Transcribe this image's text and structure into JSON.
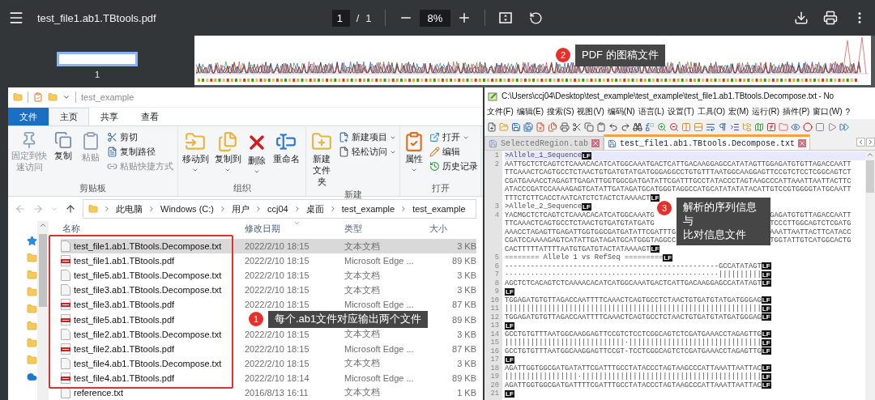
{
  "pdf_viewer": {
    "title": "test_file1.ab1.TBtools.pdf",
    "page": "1",
    "page_separator": "/",
    "page_total": "1",
    "zoom": "8%",
    "thumbnail_label": "1",
    "callout": {
      "number": "2",
      "lines": [
        "PDF 的图稿文件"
      ]
    }
  },
  "explorer": {
    "title": "test_example",
    "tabs": [
      {
        "label": "文件",
        "kind": "menu",
        "selected": false
      },
      {
        "label": "主页",
        "kind": "tab",
        "selected": true
      },
      {
        "label": "共享",
        "kind": "tab",
        "selected": false
      },
      {
        "label": "查看",
        "kind": "tab",
        "selected": false
      }
    ],
    "ribbon": [
      {
        "label": "剪贴板",
        "large": [
          {
            "label": "固定到快速访问",
            "has_menu": false,
            "disabled": true
          },
          {
            "label": "复制",
            "has_menu": false,
            "disabled": false
          },
          {
            "label": "粘贴",
            "has_menu": false,
            "disabled": true
          }
        ],
        "small": [
          {
            "label": "剪切",
            "has_menu": false,
            "disabled": false
          },
          {
            "label": "复制路径",
            "has_menu": false,
            "disabled": false
          },
          {
            "label": "粘贴快捷方式",
            "has_menu": false,
            "disabled": true
          }
        ]
      },
      {
        "label": "组织",
        "large": [
          {
            "label": "移动到",
            "has_menu": true,
            "disabled": false
          },
          {
            "label": "复制到",
            "has_menu": true,
            "disabled": false
          },
          {
            "label": "删除",
            "has_menu": true,
            "disabled": false
          },
          {
            "label": "重命名",
            "has_menu": false,
            "disabled": false
          }
        ]
      },
      {
        "label": "新建",
        "large": [
          {
            "label": "新建文件夹",
            "has_menu": false,
            "disabled": false
          }
        ],
        "small": [
          {
            "label": "新建项目",
            "has_menu": true,
            "disabled": false
          },
          {
            "label": "轻松访问",
            "has_menu": true,
            "disabled": false
          }
        ]
      },
      {
        "label": "打开",
        "large": [
          {
            "label": "属性",
            "has_menu": true,
            "disabled": false
          }
        ],
        "small": [
          {
            "label": "打开",
            "has_menu": true,
            "disabled": false
          },
          {
            "label": "编辑",
            "has_menu": false,
            "disabled": false
          },
          {
            "label": "历史记录",
            "has_menu": false,
            "disabled": false
          }
        ]
      }
    ],
    "breadcrumbs": [
      "此电脑",
      "Windows (C:)",
      "用户",
      "ccj04",
      "桌面",
      "test_example",
      "test_example"
    ],
    "columns": [
      "名称",
      "修改日期",
      "类型",
      "大小"
    ],
    "rows": [
      {
        "kind": "txt",
        "name": "test_file1.ab1.TBtools.Decompose.txt",
        "date": "2022/2/10 18:15",
        "type": "文本文档",
        "size": "3 KB",
        "selected": true,
        "boxed": true
      },
      {
        "kind": "pdf",
        "name": "test_file1.ab1.TBtools.pdf",
        "date": "2022/2/10 18:15",
        "type": "Microsoft Edge ...",
        "size": "89 KB",
        "selected": false,
        "boxed": true
      },
      {
        "kind": "txt",
        "name": "test_file5.ab1.TBtools.Decompose.txt",
        "date": "2022/2/10 18:15",
        "type": "文本文档",
        "size": "3 KB",
        "selected": false,
        "boxed": true
      },
      {
        "kind": "txt",
        "name": "test_file3.ab1.TBtools.Decompose.txt",
        "date": "2022/2/10 18:15",
        "type": "文本文档",
        "size": "3 KB",
        "selected": false,
        "boxed": true
      },
      {
        "kind": "pdf",
        "name": "test_file3.ab1.TBtools.pdf",
        "date": "2022/2/10 18:15",
        "type": "Microsoft Edge ...",
        "size": "87 KB",
        "selected": false,
        "boxed": true
      },
      {
        "kind": "pdf",
        "name": "test_file5.ab1.TBtools.pdf",
        "size": "89 KB",
        "selected": false,
        "boxed": true
      },
      {
        "kind": "txt",
        "name": "test_file2.ab1.TBtools.Decompose.txt",
        "date": "2022/2/10 18:15",
        "type": "文本文档",
        "size": "3 KB",
        "selected": false,
        "boxed": true
      },
      {
        "kind": "pdf",
        "name": "test_file2.ab1.TBtools.pdf",
        "date": "2022/2/10 18:15",
        "type": "Microsoft Edge ...",
        "size": "87 KB",
        "selected": false,
        "boxed": true
      },
      {
        "kind": "txt",
        "name": "test_file4.ab1.TBtools.Decompose.txt",
        "date": "2022/2/10 18:15",
        "type": "文本文档",
        "size": "3 KB",
        "selected": false,
        "boxed": true
      },
      {
        "kind": "pdf",
        "name": "test_file4.ab1.TBtools.pdf",
        "date": "2022/2/10 18:14",
        "type": "Microsoft Edge ...",
        "size": "89 KB",
        "selected": false,
        "boxed": true
      },
      {
        "kind": "txt",
        "name": "reference.txt",
        "date": "2016/8/13 16:11",
        "type": "文本文档",
        "size": "1 KB",
        "selected": false,
        "boxed": false
      }
    ],
    "callout": {
      "number": "1",
      "lines": [
        "每个.ab1文件对应输出两个文件"
      ]
    }
  },
  "notepad": {
    "title": "C:\\Users\\ccj04\\Desktop\\test_example\\test_example\\test_file1.ab1.TBtools.Decompose.txt - No",
    "menu": [
      "文件(F)",
      "编辑(E)",
      "搜索(S)",
      "视图(V)",
      "编码(N)",
      "语言(L)",
      "设置(T)",
      "工具(O)",
      "宏(M)",
      "运行(R)",
      "插件(P)",
      "窗口(W)",
      "?"
    ],
    "tabs": [
      {
        "label": "SelectedRegion.tab",
        "selected": false
      },
      {
        "label": "test_file1.ab1.TBtools.Decompose.txt",
        "selected": true
      }
    ],
    "lines": [
      {
        "number": "1",
        "current": true,
        "eol": "LF",
        "segments": [
          ">Allele_1_Sequence"
        ]
      },
      {
        "number": "2",
        "current": false,
        "segments": [
          "AATTGCTCTCAGTCTCAAACACATCATGGCAAATGACTCATTGACAAGGAGCCATATAGTTGGAGATGTGTTAGACCAATT",
          "TTCAAACTCAGTGCCTCTAACTGTGATGTATGATGGGAGGCCTGTGTTTAATGGCAAGGAGTTCCGTCTCCTCGGCAGTCT",
          "CGATGAAACCTAGAGTTGAGATTGGTGGCGATGATATTCGATTTGCCTATACCCTAGTAAGCCCATTAAATTAATTACTTC",
          "ATACCCGATCCAAAAGAGTCATATTGATAGATGCATGGGTAGGCCATGCATATATATACATTGTCCGTGGGGTATGCAATT",
          "TTTCTCTTCACCTAATCATCTCTACTCTAAAACT"
        ],
        "eol": "LF"
      },
      {
        "number": "3",
        "current": false,
        "eol": "LF",
        "segments": [
          ">Allele_2_Sequence"
        ]
      },
      {
        "number": "4",
        "current": false,
        "segments": [
          [
            "YACMGCTCTCAGTCTCAAACACATCATGGCAAATG",
            "GAGATGTGTTAGACCAATT"
          ],
          [
            "TTCAAACTCAGTGCCTCTAACTGTGATGTATGATG",
            "TCCCTTGGCAGTCTCGATG"
          ],
          [
            "AAACCTAGAGTTGAGATTGGTGGCGATGATATTCGATTTG",
            "AAATTAATTACTTCATACC"
          ],
          [
            "CGATCCAAAAGAGTCATATTGATAGATGCATGGGTAGGCC",
            "TGGTATTGTCATGGCACTG"
          ],
          "CACTTTTTATTTTAATGTGATGTACTATAAAAGT"
        ],
        "eol": "LF"
      },
      {
        "number": "5",
        "current": false,
        "eol": "LF",
        "segments": [
          "======== Allele 1 vs RefSeq ========="
        ]
      },
      {
        "number": "6",
        "current": false,
        "eol": "LF",
        "segments": [
          "--------------------------------------------------GCCATATAGT"
        ]
      },
      {
        "number": "7",
        "current": false,
        "eol": "LF",
        "segments": [
          "··················································||||||||||"
        ]
      },
      {
        "number": "8",
        "current": false,
        "eol": "LF",
        "segments": [
          "AGCTCTCACAGTCTCAAAACACATCATGGCAAATGACTCATTGACAAGGAGCCATATAGT"
        ]
      },
      {
        "number": "9",
        "current": false,
        "eol": "LF"
      },
      {
        "number": "10",
        "current": false,
        "eol": "LF",
        "segments": [
          "TGGAGATGTGTTAGACCAATTTTCAAACTCAGTGCCTCTAACTGTGATGTATGATGGGAG"
        ]
      },
      {
        "number": "11",
        "current": false,
        "eol": "LF",
        "segments": [
          "||||||||||||||||||||||||||||||||||||||||||||||||||||||||||||"
        ]
      },
      {
        "number": "12",
        "current": false,
        "eol": "LF",
        "segments": [
          "TGGAGATGTGTTAGACCAATTTTCAAACTCAGTGCCTCTAACTGTGATGTATGATGGGAG"
        ]
      },
      {
        "number": "13",
        "current": false,
        "eol": "LF"
      },
      {
        "number": "14",
        "current": false,
        "eol": "LF",
        "segments": [
          "GCCTGTGTTTAATGGCAAGGAGTTCCGTCTCCTCGGCAGTCTCGATGAAACCTAGAGTTG"
        ]
      },
      {
        "number": "15",
        "current": false,
        "eol": "LF",
        "segments": [
          "||||||||||||||||||||||||||||·|||||||||||||||||||||||||||||||"
        ]
      },
      {
        "number": "16",
        "current": false,
        "eol": "LF",
        "segments": [
          "GCCTGTGTTTAATGGCAAGGAGTTCCGT-TCCTCGGCAGTCTCGATGAAACCTAGAGTTG"
        ]
      },
      {
        "number": "17",
        "current": false,
        "eol": "LF"
      },
      {
        "number": "18",
        "current": false,
        "eol": "LF",
        "segments": [
          "AGATTGGTGGCGATGATATTCGATTTGCCTATACCCTAGTAAGCCCATTAAATTAATTAC"
        ]
      },
      {
        "number": "19",
        "current": false,
        "eol": "LF",
        "segments": [
          "|||||||||||||||||·||||||||||||||||||||||||||||||||||||||||||"
        ]
      },
      {
        "number": "20",
        "current": false,
        "eol": "LF",
        "segments": [
          "AGATTGGTGGCGATGATTTTCGATTTGCCTATACCCTAGTAAGCCCATTAAATTAATTAC"
        ]
      },
      {
        "number": "21",
        "current": false,
        "eol": "LF"
      }
    ],
    "callout": {
      "number": "3",
      "lines": [
        "解析的序列信息",
        "与",
        "比对信息文件"
      ]
    }
  }
}
